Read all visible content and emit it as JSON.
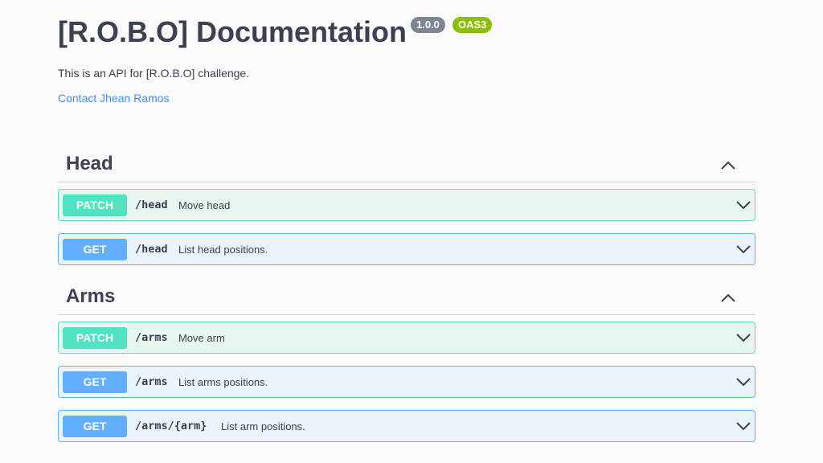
{
  "info": {
    "title": "[R.O.B.O] Documentation",
    "version": "1.0.0",
    "spec": "OAS3",
    "description": "This is an API for [R.O.B.O] challenge.",
    "contact": "Contact Jhean Ramos"
  },
  "colors": {
    "patch": "#50e3c2",
    "get": "#61affe",
    "version_badge": "#7d8492",
    "oas_badge": "#89bf04",
    "link": "#4990e2"
  },
  "sections": [
    {
      "title": "Head",
      "toggle_icon": "chevron-up-icon",
      "operations": [
        {
          "method": "PATCH",
          "path": "/head",
          "summary": "Move head"
        },
        {
          "method": "GET",
          "path": "/head",
          "summary": "List head positions."
        }
      ]
    },
    {
      "title": "Arms",
      "toggle_icon": "chevron-up-icon",
      "operations": [
        {
          "method": "PATCH",
          "path": "/arms",
          "summary": "Move arm"
        },
        {
          "method": "GET",
          "path": "/arms",
          "summary": "List arms positions."
        },
        {
          "method": "GET",
          "path": "/arms/{arm}",
          "summary": "List arm positions."
        }
      ]
    }
  ]
}
